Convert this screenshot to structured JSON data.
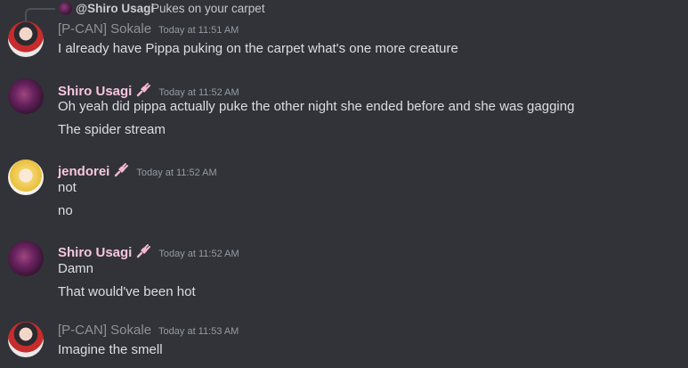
{
  "reply": {
    "author": "@Shiro Usagi",
    "text": "Pukes on your carpet"
  },
  "messages": [
    {
      "author": "[P-CAN] Sokale",
      "time": "Today at 11:51 AM",
      "lines": [
        "I already have Pippa puking on the carpet what's one more creature"
      ]
    },
    {
      "author": "Shiro Usagi",
      "time": "Today at 11:52 AM",
      "lines": [
        "Oh yeah did pippa actually puke the other night she ended before and she was gagging",
        "The spider stream"
      ]
    },
    {
      "author": "jendorei",
      "time": "Today at 11:52 AM",
      "lines": [
        "not",
        "no"
      ]
    },
    {
      "author": "Shiro Usagi",
      "time": "Today at 11:52 AM",
      "lines": [
        "Damn",
        "That would've been hot"
      ]
    },
    {
      "author": "[P-CAN] Sokale",
      "time": "Today at 11:53 AM",
      "lines": [
        "Imagine the smell"
      ]
    }
  ],
  "icons": {
    "badge": "plug-icon",
    "badge_color": "#f4b6d3"
  }
}
